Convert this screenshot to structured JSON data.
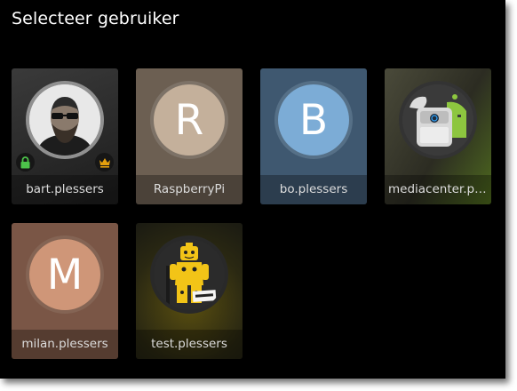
{
  "title": "Selecteer gebruiker",
  "users": [
    {
      "name": "bart.plessers",
      "avatar": "photo-icon",
      "tile_color": "#2a2a2a",
      "avatar_color": "#d8d8d8",
      "badges": [
        "lock-icon",
        "crown-icon"
      ]
    },
    {
      "name": "RaspberryPi",
      "avatar": "letter",
      "letter": "R",
      "tile_color": "#6c5f52",
      "avatar_color": "#c4b09b"
    },
    {
      "name": "bo.plessers",
      "avatar": "letter",
      "letter": "B",
      "tile_color": "#3f5870",
      "avatar_color": "#7cacd6"
    },
    {
      "name": "mediacenter.plessers",
      "avatar": "media-icon",
      "tile_color": "#333428",
      "avatar_color": "#8dc63f"
    },
    {
      "name": "milan.plessers",
      "avatar": "letter",
      "letter": "M",
      "tile_color": "#7a5646",
      "avatar_color": "#cf9678"
    },
    {
      "name": "test.plessers",
      "avatar": "lego-icon",
      "tile_color": "#2a2812",
      "avatar_color": "#6a5a10"
    }
  ],
  "colors": {
    "background": "#000000",
    "title": "#ffffff",
    "label": "#dcdcdc",
    "lock": "#4cc24a",
    "crown": "#e5a00d"
  }
}
